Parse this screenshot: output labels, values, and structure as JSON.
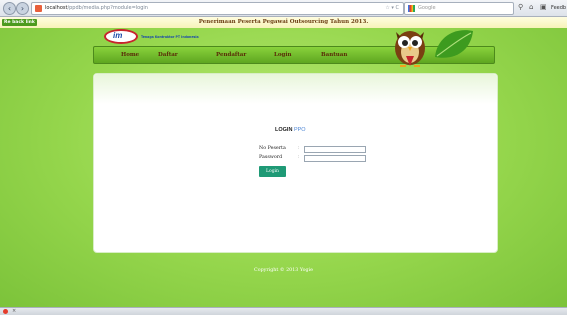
{
  "browser": {
    "back_icon": "back-arrow-icon",
    "forward_icon": "forward-arrow-icon",
    "url_host": "localhost",
    "url_path": "/ppdb/media.php?module=login",
    "search_engine": "Google",
    "feedback_label": "Feedb"
  },
  "topstrip": {
    "back_link": "Re back link",
    "title": "Penerimaan Peserta Pegawai Outsourcing Tahun 2013."
  },
  "logo": {
    "text": "im",
    "tagline": "Tenaga Kontraktor PT Indonesia"
  },
  "nav": {
    "items": [
      "Home",
      "Daftar",
      "Pendaftar",
      "Login",
      "Bantuan"
    ]
  },
  "login": {
    "title_main": "LOGIN",
    "title_accent": "PPO",
    "fields": [
      {
        "label": "No Peserta",
        "value": ""
      },
      {
        "label": "Password",
        "value": ""
      }
    ],
    "separator": ":",
    "button": "Login"
  },
  "footer": {
    "copyright": "Copyright © 2013 Yogie"
  },
  "colors": {
    "page_green": "#8fd44a",
    "nav_text": "#5a2c07",
    "button": "#1f9a76",
    "title_accent": "#4d86d6"
  }
}
